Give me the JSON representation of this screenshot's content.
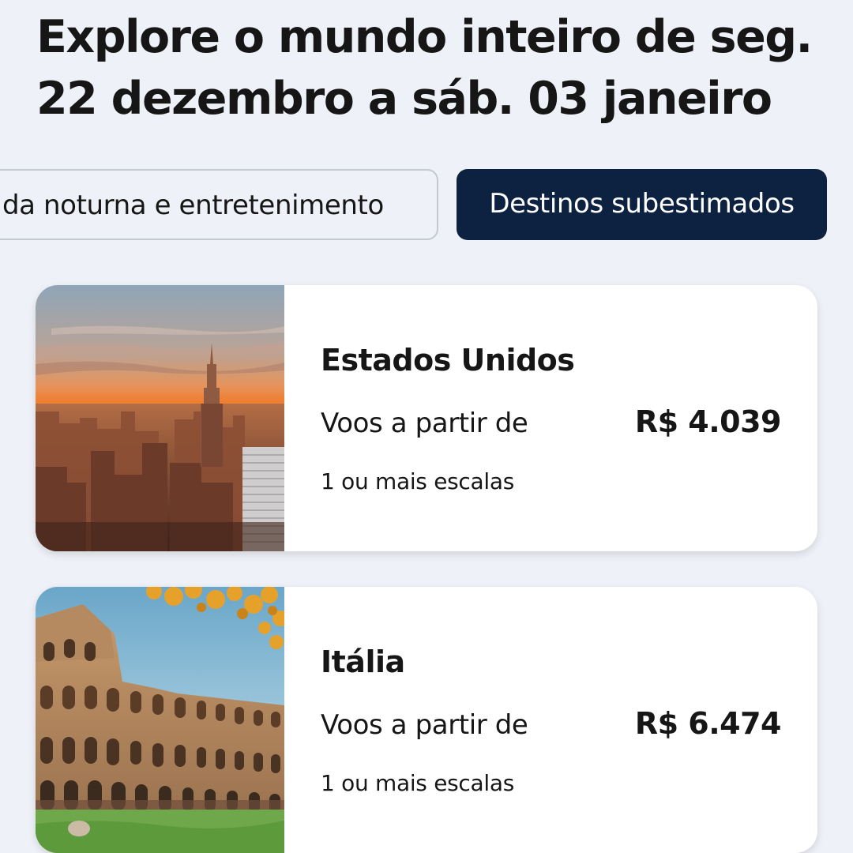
{
  "header": {
    "title": "Explore o mundo inteiro de seg. 22 dezembro a sáb. 03 janeiro"
  },
  "filters": {
    "chips": [
      {
        "label": "Vida noturna e entretenimento",
        "visible_text": "da noturna e entretenimento",
        "selected": false
      },
      {
        "label": "Destinos subestimados",
        "selected": true
      }
    ]
  },
  "destinations": [
    {
      "name": "Estados Unidos",
      "from_label": "Voos a partir de",
      "price": "R$ 4.039",
      "stops": "1 ou mais escalas",
      "image": "new-york-skyline-sunset"
    },
    {
      "name": "Itália",
      "from_label": "Voos a partir de",
      "price": "R$ 6.474",
      "stops": "1 ou mais escalas",
      "image": "colosseum-rome"
    }
  ],
  "colors": {
    "background": "#eef1f7",
    "chip_active": "#0d2240",
    "chip_border": "#c3c8d1",
    "card": "#ffffff",
    "text": "#161616"
  }
}
